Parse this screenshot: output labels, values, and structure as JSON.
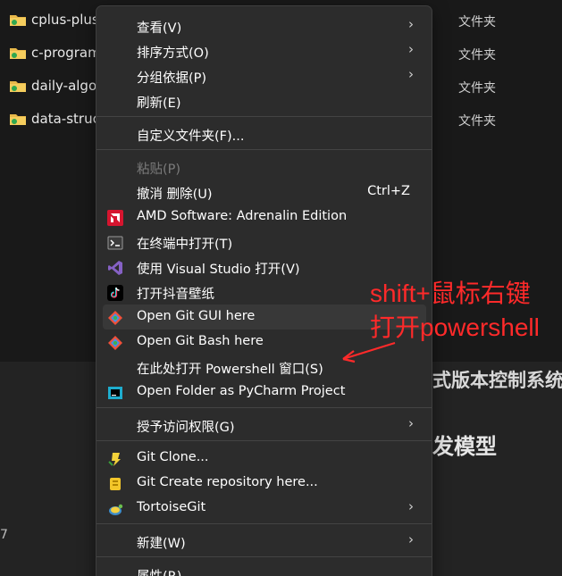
{
  "files": [
    {
      "name": "cplus-plus",
      "type": "文件夹"
    },
    {
      "name": "c-program",
      "type": "文件夹"
    },
    {
      "name": "daily-algo",
      "type": "文件夹"
    },
    {
      "name": "data-struc",
      "type": "文件夹"
    }
  ],
  "background": {
    "text1": "式版本控制系统",
    "text2": "发模型",
    "digit": "7"
  },
  "menu": {
    "view": "查看(V)",
    "sort": "排序方式(O)",
    "group": "分组依据(P)",
    "refresh": "刷新(E)",
    "customize": "自定义文件夹(F)...",
    "paste": "粘贴(P)",
    "undo": "撤消 删除(U)",
    "undo_shortcut": "Ctrl+Z",
    "amd": "AMD Software: Adrenalin Edition",
    "terminal": "在终端中打开(T)",
    "vs": "使用 Visual Studio 打开(V)",
    "douyin": "打开抖音壁纸",
    "git_gui": "Open Git GUI here",
    "git_bash": "Open Git Bash here",
    "powershell": "在此处打开 Powershell 窗口(S)",
    "pycharm": "Open Folder as PyCharm Project",
    "access": "授予访问权限(G)",
    "git_clone": "Git Clone...",
    "git_create": "Git Create repository here...",
    "tortoise": "TortoiseGit",
    "new": "新建(W)",
    "properties": "属性(R)"
  },
  "annotation": {
    "line1": "shift+鼠标右键",
    "line2": "打开powershell"
  },
  "colors": {
    "annotation": "#ff2a2a",
    "menu_bg": "#2c2c2c",
    "hover_bg": "#383838"
  }
}
